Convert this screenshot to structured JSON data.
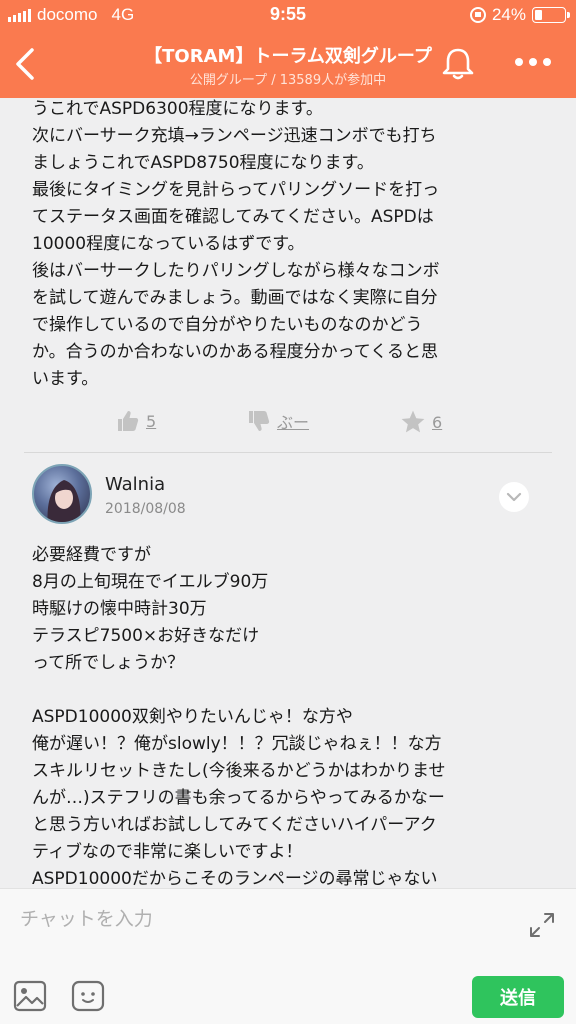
{
  "status_bar": {
    "carrier": "docomo",
    "network": "4G",
    "time": "9:55",
    "battery_text": "24%",
    "battery_level": 0.24
  },
  "header": {
    "title": "【TORAM】トーラム双剣グループ",
    "subtitle": "公開グループ / 13589人が参加中",
    "icons": {
      "back": "chevron-left-icon",
      "bell": "bell-icon",
      "more": "more-dots-icon"
    }
  },
  "post1": {
    "body": "うこれでASPD6300程度になります。\n次にバーサーク充填→ランページ迅速コンボでも打ち\nましょうこれでASPD8750程度になります。\n最後にタイミングを見計らってパリングソードを打っ\nてステータス画面を確認してみてください。ASPDは\n10000程度になっているはずです。\n後はバーサークしたりパリングしながら様々なコンボ\nを試して遊んでみましょう。動画ではなく実際に自分\nで操作しているので自分がやりたいものなのかどう\nか。合うのか合わないのかある程度分かってくると思\nいます。",
    "reactions": {
      "like_count": "5",
      "boo_label": "ぶー",
      "favorite_count": "6"
    }
  },
  "post2": {
    "author": "Walnia",
    "date": "2018/08/08",
    "body": "必要経費ですが\n8月の上旬現在でイエルブ90万\n時駆けの懐中時計30万\nテラスピ7500×お好きなだけ\nって所でしょうか？\n\nASPD10000双剣やりたいんじゃ！な方や\n俺が遅い！？俺がslowly！！？冗談じゃねぇ！！な方\nスキルリセットきたし(今後来るかどうかはわかりませ\nんが…)ステフリの書も余ってるからやってみるかなー\nと思う方いればお試ししてみてくださいハイパーアク\nティブなので非常に楽しいですよ！\nASPD10000だからこそのランページの尋常じゃない\n通常攻撃速度！ファントムのズババババー！感やクリ"
  },
  "footer": {
    "input_placeholder": "チャットを入力",
    "send_label": "送信"
  },
  "colors": {
    "header_bg": "#fa7a4f",
    "send_bg": "#2fc45d",
    "page_bg": "#efeff0"
  }
}
